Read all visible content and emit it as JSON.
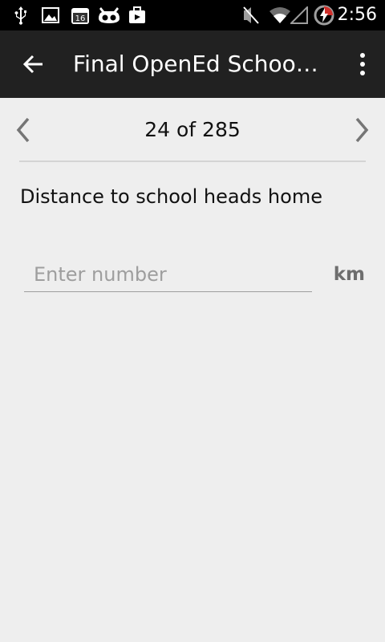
{
  "status_bar": {
    "time": "2:56",
    "notification_icons": [
      "usb-icon",
      "image-icon",
      "calendar-16-icon",
      "robot-icon",
      "briefcase-icon"
    ],
    "system_icons": [
      "muted-icon",
      "wifi-icon",
      "signal-icon",
      "battery-charging-icon"
    ],
    "calendar_badge": "16"
  },
  "app_bar": {
    "title": "Final OpenEd School…",
    "back_icon": "arrow-back-icon",
    "menu_icon": "overflow-menu-icon"
  },
  "pager": {
    "counter": "24 of 285",
    "prev_icon": "chevron-left-icon",
    "next_icon": "chevron-right-icon"
  },
  "question": {
    "label": "Distance to school heads home",
    "placeholder": "Enter number",
    "value": "",
    "unit": "km"
  },
  "colors": {
    "status_bar": "#000000",
    "app_bar": "#212121",
    "background": "#eeeeee",
    "divider": "#d4d4d4",
    "unit_text": "#6e6e6e"
  }
}
